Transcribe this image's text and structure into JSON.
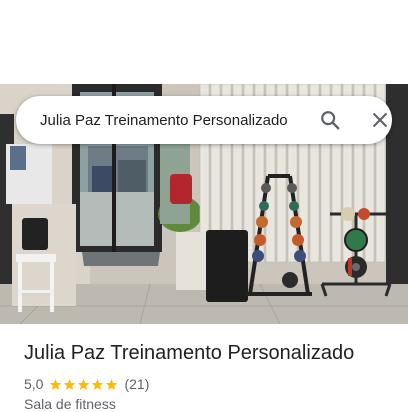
{
  "search": {
    "query": "Julia Paz Treinamento Personalizado"
  },
  "place": {
    "name": "Julia Paz Treinamento Personalizado",
    "rating": "5,0",
    "stars": 5,
    "review_count": "(21)",
    "category": "Sala de fitness"
  },
  "icons": {
    "search": "search-icon",
    "close": "close-icon",
    "star": "star-icon"
  },
  "colors": {
    "star": "#fbbc04",
    "text": "#202124",
    "secondary": "#5f6368"
  }
}
